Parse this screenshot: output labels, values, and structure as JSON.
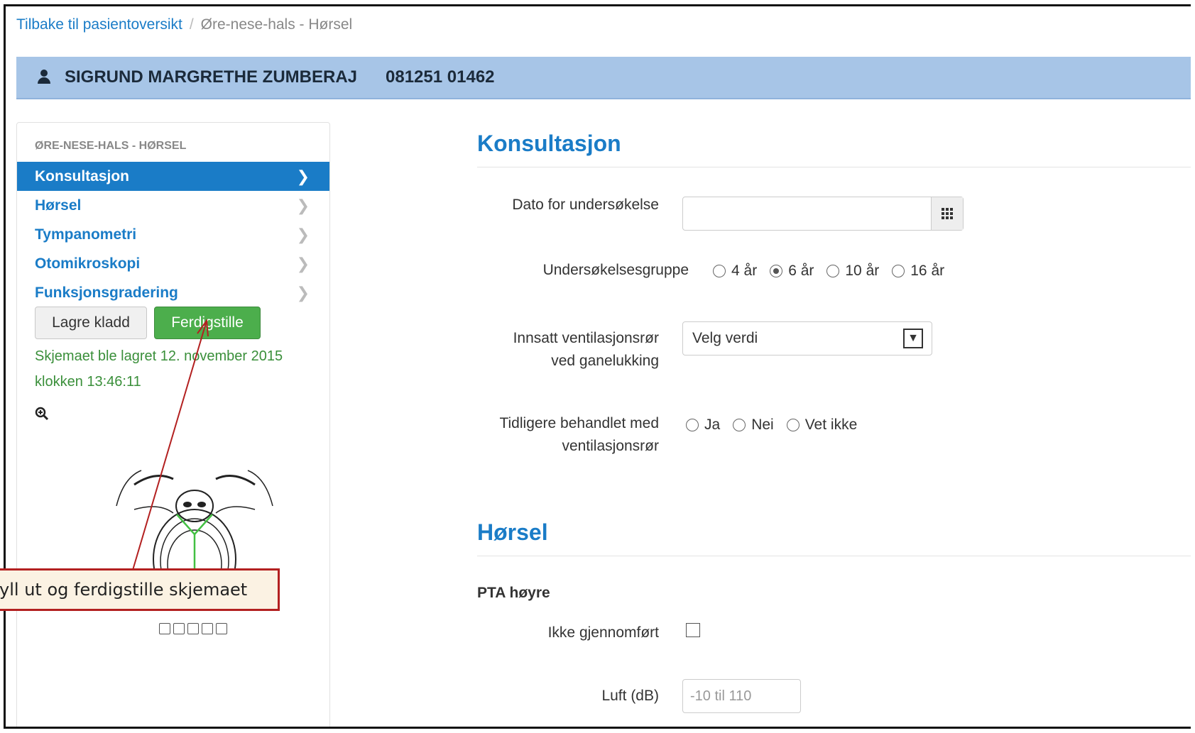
{
  "breadcrumb": {
    "back_link": "Tilbake til pasientoversikt",
    "separator": "/",
    "current": "Øre-nese-hals - Hørsel"
  },
  "patient": {
    "name": "SIGRUND MARGRETHE ZUMBERAJ",
    "id": "081251 01462"
  },
  "sidebar": {
    "section_title": "ØRE-NESE-HALS - HØRSEL",
    "items": [
      {
        "label": "Konsultasjon",
        "active": true
      },
      {
        "label": "Hørsel",
        "active": false
      },
      {
        "label": "Tympanometri",
        "active": false
      },
      {
        "label": "Otomikroskopi",
        "active": false
      },
      {
        "label": "Funksjonsgradering",
        "active": false
      }
    ],
    "draft_button": "Lagre kladd",
    "finish_button": "Ferdigstille",
    "saved_message": "Skjemaet ble lagret 12. november 2015 klokken 13:46:11"
  },
  "annotation": {
    "text": "fyll ut og ferdigstille skjemaet"
  },
  "main": {
    "consultation_title": "Konsultasjon",
    "date_label": "Dato for undersøkelse",
    "date_value": "",
    "group_label": "Undersøkelsesgruppe",
    "group_options": [
      "4 år",
      "6 år",
      "10 år",
      "16 år"
    ],
    "group_selected": "6 år",
    "tube_label_line1": "Innsatt ventilasjonsrør",
    "tube_label_line2": "ved ganelukking",
    "tube_select": "Velg verdi",
    "prev_label_line1": "Tidligere behandlet med",
    "prev_label_line2": "ventilasjonsrør",
    "prev_options": [
      "Ja",
      "Nei",
      "Vet ikke"
    ],
    "hearing_title": "Hørsel",
    "pta_title": "PTA høyre",
    "not_done_label": "Ikke gjennomført",
    "air_label": "Luft (dB)",
    "air_placeholder": "-10 til 110"
  },
  "colors": {
    "accent": "#1a7cc7",
    "patient_bar": "#a7c5e7",
    "success": "#4cae4c",
    "annotation_border": "#b32020"
  }
}
